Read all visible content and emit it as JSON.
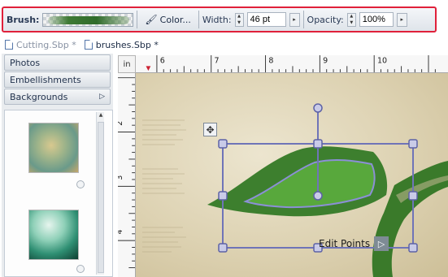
{
  "toolbar": {
    "brush_label": "Brush:",
    "color_label": "Color...",
    "width_label": "Width:",
    "width_value": "46 pt",
    "opacity_label": "Opacity:",
    "opacity_value": "100%"
  },
  "tabs": [
    {
      "label": "Cutting.Sbp *",
      "active": false
    },
    {
      "label": "brushes.Sbp *",
      "active": true
    }
  ],
  "sidebar": {
    "sections": [
      {
        "label": "Photos"
      },
      {
        "label": "Embellishments"
      },
      {
        "label": "Backgrounds"
      }
    ]
  },
  "ruler": {
    "unit": "in",
    "h_labels": [
      "6",
      "7",
      "8",
      "9",
      "10"
    ],
    "v_labels": [
      "2",
      "3",
      "4"
    ]
  },
  "canvas": {
    "edit_points_label": "Edit Points"
  },
  "colors": {
    "highlight": "#e0203a",
    "leaf_green": "#3f8a2e",
    "selection": "#6f74b8"
  }
}
